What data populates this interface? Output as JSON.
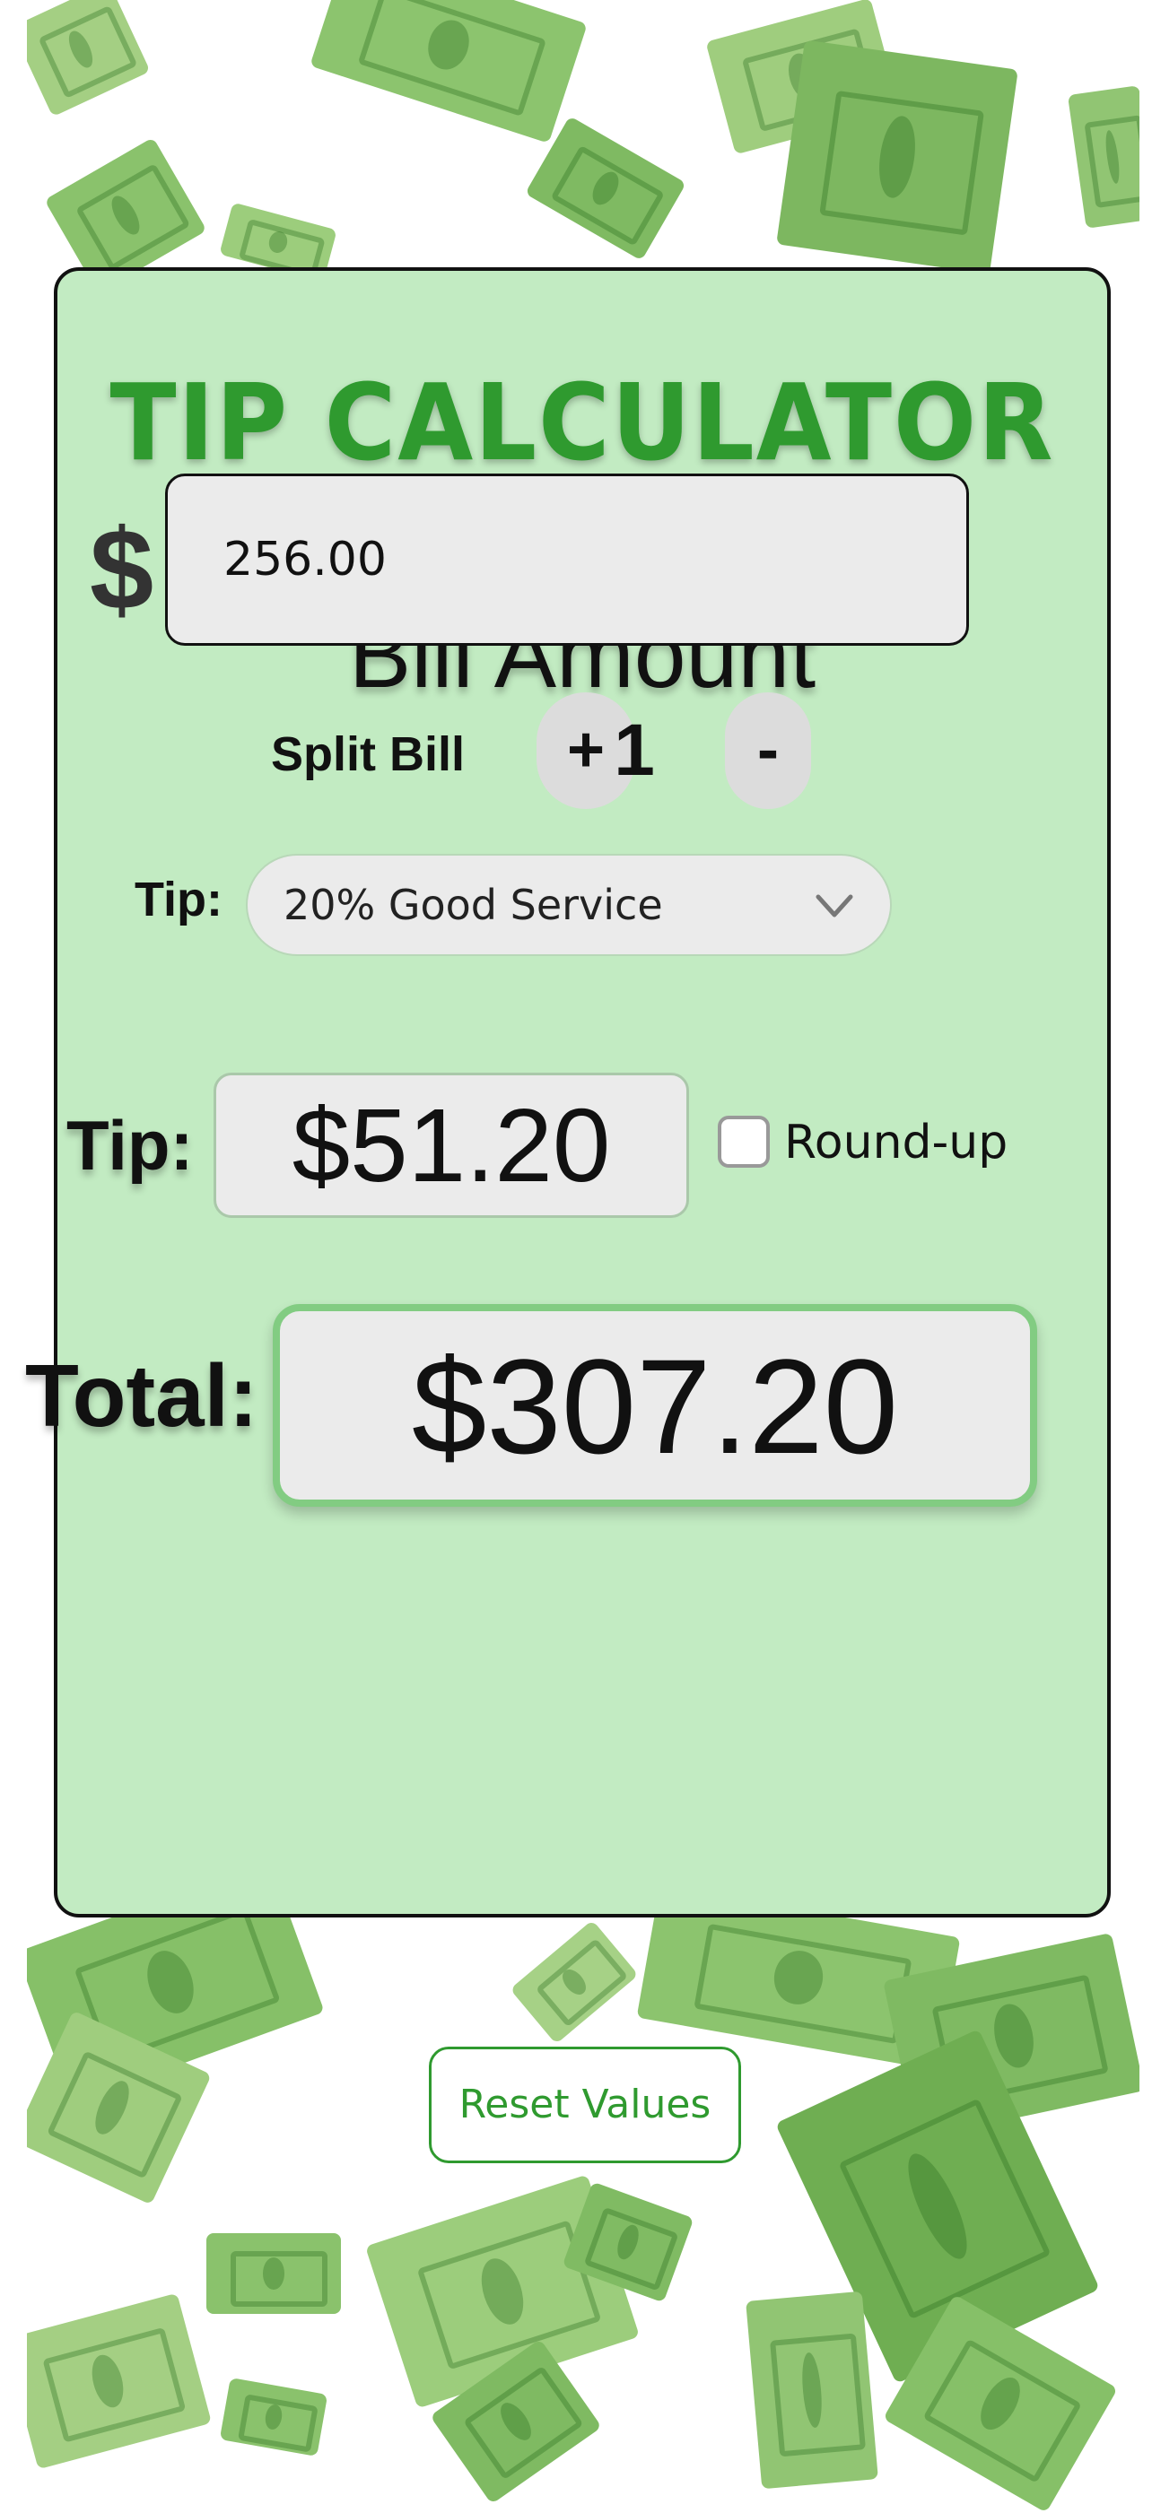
{
  "app": {
    "title": "TIP CALCULATOR",
    "bill_label": "Bill Amount",
    "currency_symbol": "$",
    "bill_value": "256.00",
    "split_label": "Split Bill",
    "split_plus": "+",
    "split_count": "1",
    "split_minus": "-",
    "tip_select_label": "Tip:",
    "tip_select_value": "20% Good Service",
    "tip_label": "Tip:",
    "tip_amount": "$51.20",
    "roundup_label": "Round-up",
    "roundup_checked": false,
    "total_label": "Total:",
    "total_amount": "$307.20",
    "reset_label": "Reset Values"
  },
  "colors": {
    "card_bg": "#c2ebc2",
    "accent_green": "#2f9a2f",
    "input_bg": "#ebebeb",
    "money_green": "#8cc46e"
  },
  "icons": {
    "dropdown": "chevron-down-icon",
    "background": "falling-money-icon"
  }
}
